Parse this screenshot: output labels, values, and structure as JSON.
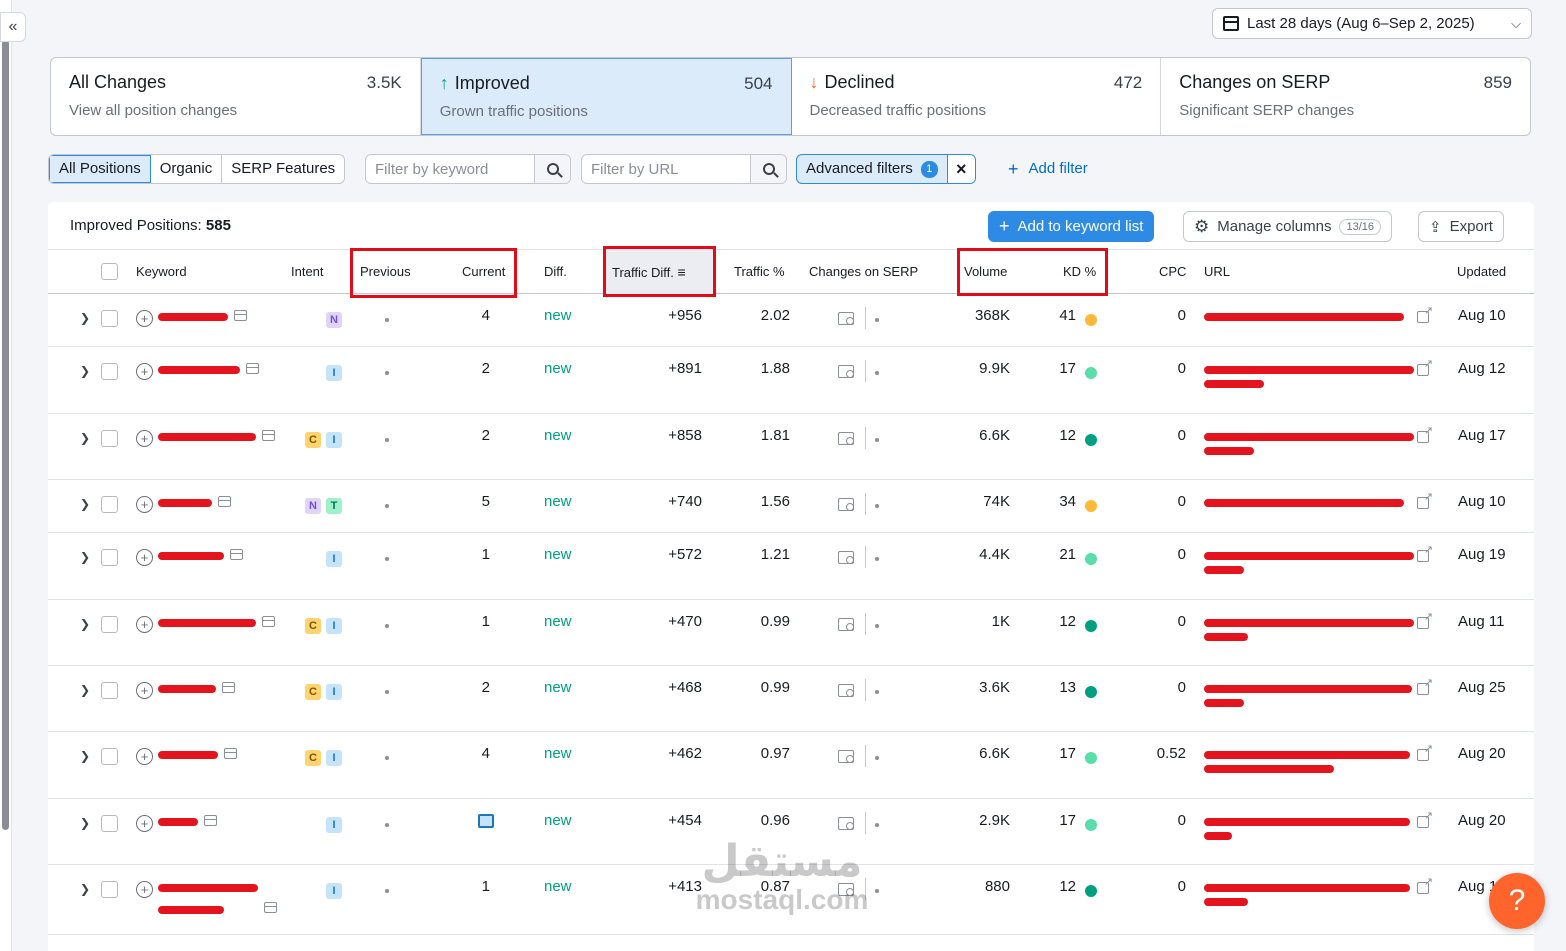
{
  "date_range": "Last 28 days (Aug 6–Sep 2, 2025)",
  "tabs": [
    {
      "title": "All Changes",
      "count": "3.5K",
      "sub": "View all position changes",
      "arrow": ""
    },
    {
      "title": "Improved",
      "count": "504",
      "sub": "Grown traffic positions",
      "arrow": "up"
    },
    {
      "title": "Declined",
      "count": "472",
      "sub": "Decreased traffic positions",
      "arrow": "down"
    },
    {
      "title": "Changes on SERP",
      "count": "859",
      "sub": "Significant SERP changes",
      "arrow": ""
    }
  ],
  "segments": [
    "All Positions",
    "Organic",
    "SERP Features"
  ],
  "filter_keyword_placeholder": "Filter by keyword",
  "filter_url_placeholder": "Filter by URL",
  "advanced_filters_label": "Advanced filters",
  "advanced_filters_count": "1",
  "add_filter_label": "Add filter",
  "panel": {
    "title_label": "Improved Positions:",
    "title_count": "585",
    "add_keyword_label": "Add to keyword list",
    "manage_columns_label": "Manage columns",
    "manage_columns_count": "13/16",
    "export_label": "Export"
  },
  "columns": {
    "keyword": "Keyword",
    "intent": "Intent",
    "previous": "Previous",
    "current": "Current",
    "diff": "Diff.",
    "traffic_diff": "Traffic Diff.",
    "traffic_pct": "Traffic %",
    "changes_serp": "Changes on SERP",
    "volume": "Volume",
    "kd": "KD %",
    "cpc": "CPC",
    "url": "URL",
    "updated": "Updated"
  },
  "colors": {
    "kd_yellow": "#ffb937",
    "kd_lightgreen": "#59ddaa",
    "kd_green": "#009f81",
    "accent": "#2d8ae5"
  },
  "rows": [
    {
      "intents": [
        "N"
      ],
      "current": "4",
      "diff": "new",
      "traffic_diff": "+956",
      "traffic_pct": "2.02",
      "volume": "368K",
      "kd": "41",
      "kd_color": "#ffb937",
      "cpc": "0",
      "updated": "Aug 10"
    },
    {
      "intents": [
        "I"
      ],
      "current": "2",
      "diff": "new",
      "traffic_diff": "+891",
      "traffic_pct": "1.88",
      "volume": "9.9K",
      "kd": "17",
      "kd_color": "#59ddaa",
      "cpc": "0",
      "updated": "Aug 12"
    },
    {
      "intents": [
        "C",
        "I"
      ],
      "current": "2",
      "diff": "new",
      "traffic_diff": "+858",
      "traffic_pct": "1.81",
      "volume": "6.6K",
      "kd": "12",
      "kd_color": "#009f81",
      "cpc": "0",
      "updated": "Aug 17"
    },
    {
      "intents": [
        "N",
        "T"
      ],
      "current": "5",
      "diff": "new",
      "traffic_diff": "+740",
      "traffic_pct": "1.56",
      "volume": "74K",
      "kd": "34",
      "kd_color": "#ffb937",
      "cpc": "0",
      "updated": "Aug 10"
    },
    {
      "intents": [
        "I"
      ],
      "current": "1",
      "diff": "new",
      "traffic_diff": "+572",
      "traffic_pct": "1.21",
      "volume": "4.4K",
      "kd": "21",
      "kd_color": "#59ddaa",
      "cpc": "0",
      "updated": "Aug 19"
    },
    {
      "intents": [
        "C",
        "I"
      ],
      "current": "1",
      "diff": "new",
      "traffic_diff": "+470",
      "traffic_pct": "0.99",
      "volume": "1K",
      "kd": "12",
      "kd_color": "#009f81",
      "cpc": "0",
      "updated": "Aug 11"
    },
    {
      "intents": [
        "C",
        "I"
      ],
      "current": "2",
      "diff": "new",
      "traffic_diff": "+468",
      "traffic_pct": "0.99",
      "volume": "3.6K",
      "kd": "13",
      "kd_color": "#009f81",
      "cpc": "0",
      "updated": "Aug 25"
    },
    {
      "intents": [
        "C",
        "I"
      ],
      "current": "4",
      "diff": "new",
      "traffic_diff": "+462",
      "traffic_pct": "0.97",
      "volume": "6.6K",
      "kd": "17",
      "kd_color": "#59ddaa",
      "cpc": "0.52",
      "updated": "Aug 20"
    },
    {
      "intents": [
        "I"
      ],
      "current": "",
      "current_icon": "image-feature-icon",
      "diff": "new",
      "traffic_diff": "+454",
      "traffic_pct": "0.96",
      "volume": "2.9K",
      "kd": "17",
      "kd_color": "#59ddaa",
      "cpc": "0",
      "updated": "Aug 20"
    },
    {
      "intents": [
        "I"
      ],
      "current": "1",
      "diff": "new",
      "traffic_diff": "+413",
      "traffic_pct": "0.87",
      "volume": "880",
      "kd": "12",
      "kd_color": "#009f81",
      "cpc": "0",
      "updated": "Aug 1"
    }
  ],
  "watermark_ar": "مستقل",
  "watermark_en": "mostaql.com",
  "help_label": "?"
}
